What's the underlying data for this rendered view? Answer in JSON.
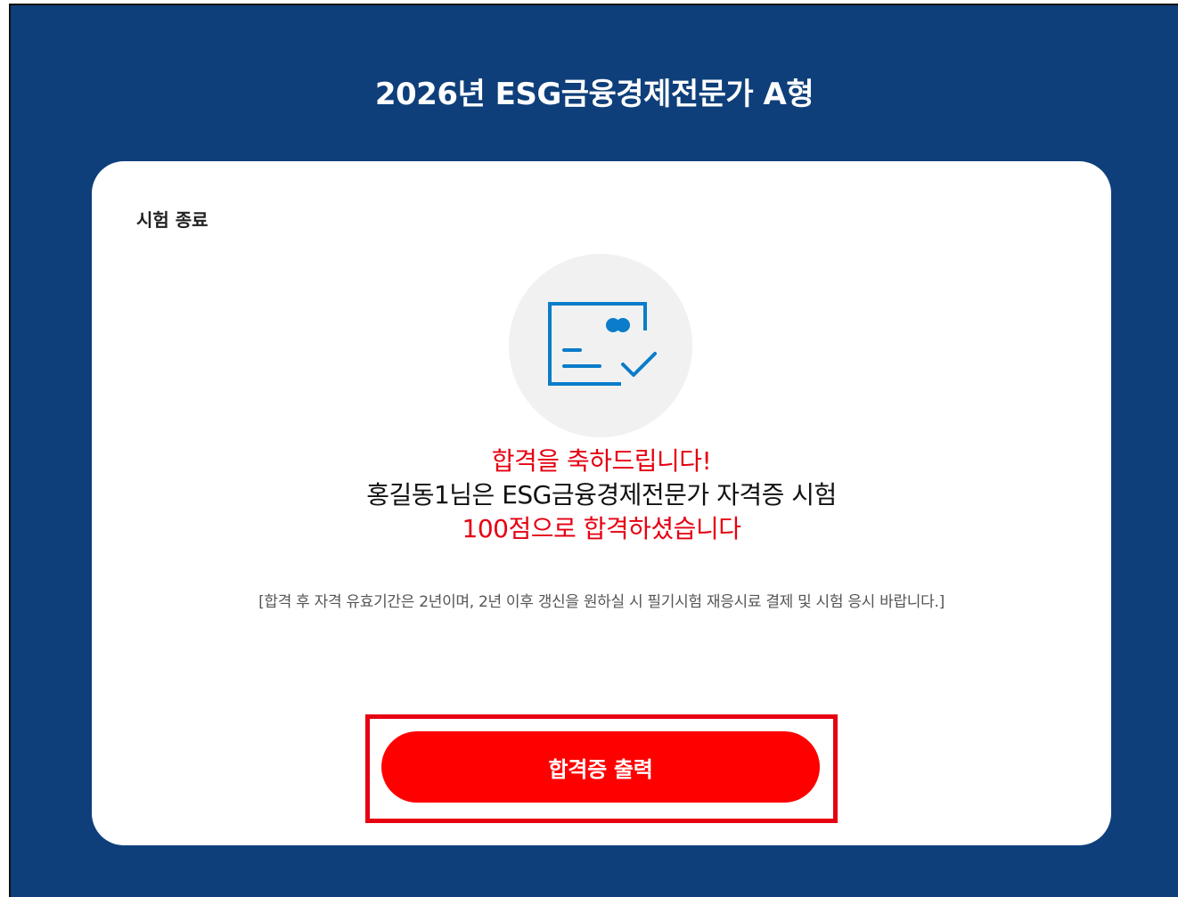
{
  "header": {
    "title": "2026년 ESG금융경제전문가 A형"
  },
  "card": {
    "heading": "시험 종료",
    "icon": "certificate-check-icon",
    "congrats": "합격을 축하드립니다!",
    "result_line": "홍길동1님은 ESG금융경제전문가 자격증 시험",
    "score_line": "100점으로 합격하셨습니다",
    "notice": "[합격 후 자격 유효기간은 2년이며, 2년 이후 갱신을 원하실 시 필기시험 재응시료 결제 및 시험 응시 바랍니다.]",
    "print_button": "합격증 출력"
  },
  "colors": {
    "background": "#0e3f7a",
    "accent_red": "#e60012",
    "button_red": "#ff0000",
    "icon_blue": "#0a7cc9"
  }
}
